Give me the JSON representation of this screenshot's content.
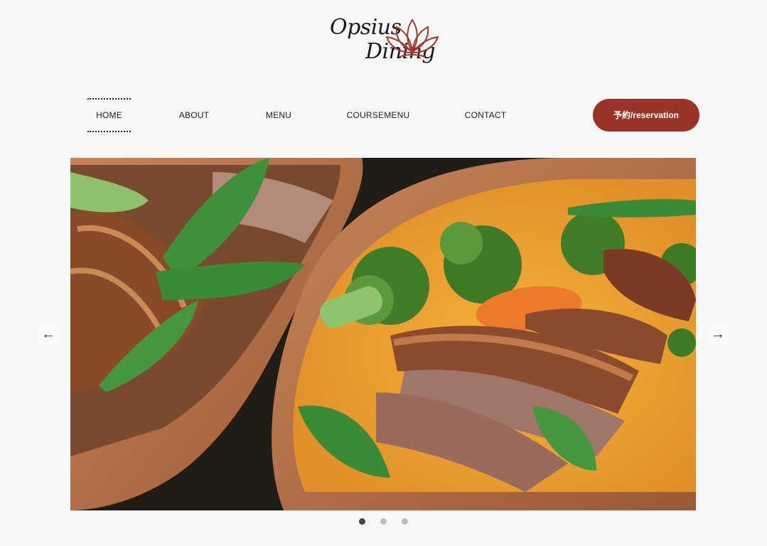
{
  "logo": {
    "line1": "Opsius",
    "line2": "Dining"
  },
  "nav": {
    "items": [
      {
        "label": "HOME",
        "active": true
      },
      {
        "label": "ABOUT"
      },
      {
        "label": "MENU"
      },
      {
        "label": "COURSEMENU"
      },
      {
        "label": "CONTACT"
      }
    ],
    "reservation_label": "予約/reservation"
  },
  "slider": {
    "prev_arrow": "←",
    "next_arrow": "→",
    "slide_count": 3,
    "active_slide": 1,
    "image_subject": "duck breast with broccoli, snow peas and carrot in curry"
  },
  "colors": {
    "background": "#f7f7f7",
    "accent": "#9b3428",
    "logo_lotus": "#a03a2c"
  }
}
